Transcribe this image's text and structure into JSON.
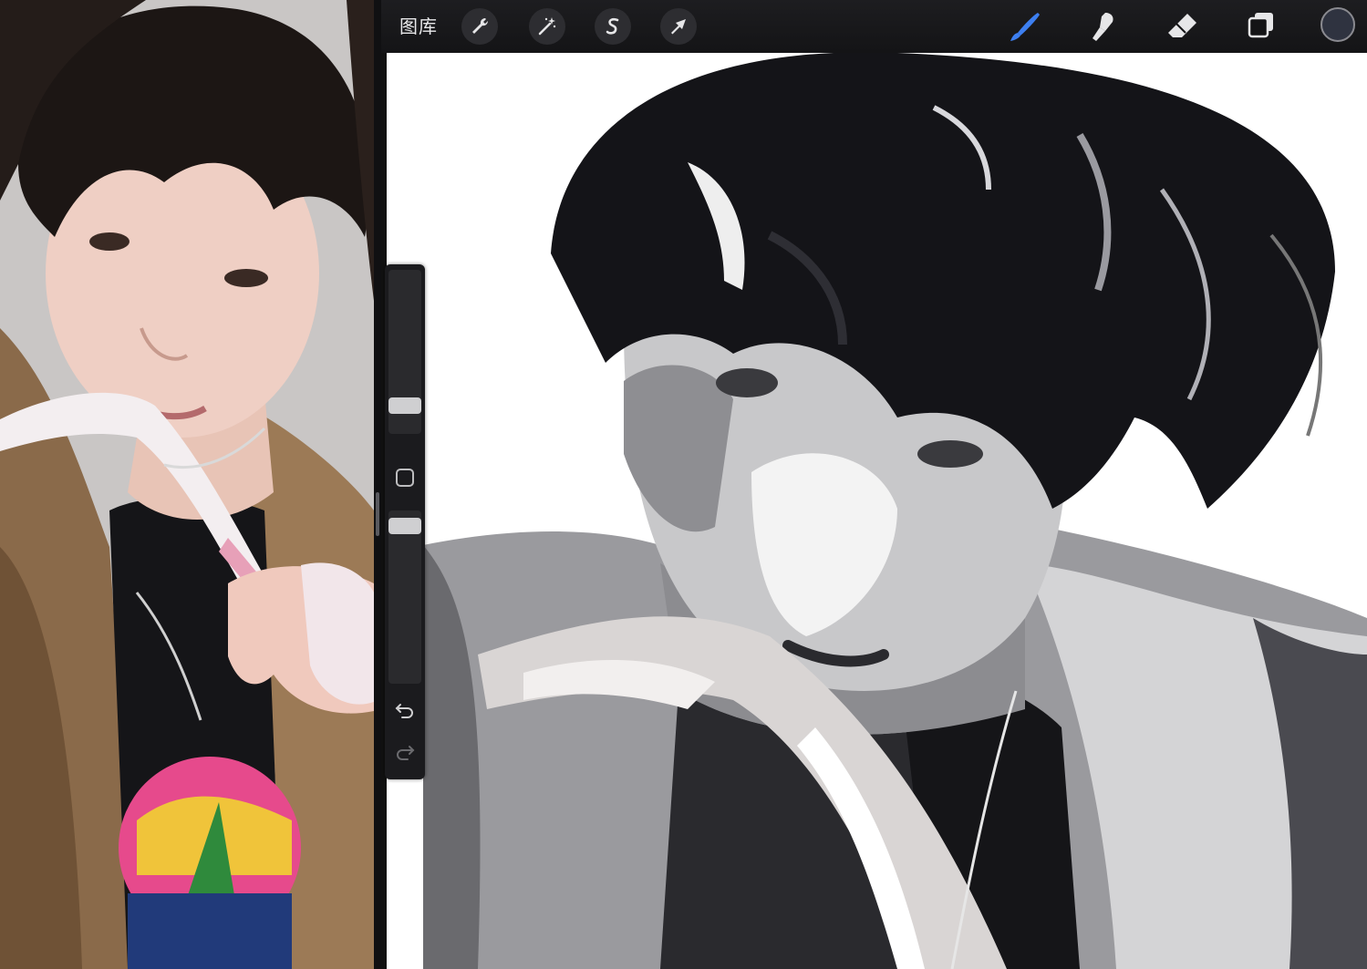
{
  "toolbar": {
    "gallery_label": "图库",
    "left_tools": [
      {
        "icon": "wrench-icon",
        "name": "actions"
      },
      {
        "icon": "magic-wand-icon",
        "name": "adjustments"
      },
      {
        "icon": "selection-s-icon",
        "name": "selection"
      },
      {
        "icon": "arrow-cursor-icon",
        "name": "transform"
      }
    ],
    "right_tools": [
      {
        "icon": "brush-icon",
        "name": "paint",
        "active_color": "#3d7ff0"
      },
      {
        "icon": "smudge-icon",
        "name": "smudge"
      },
      {
        "icon": "eraser-icon",
        "name": "eraser"
      },
      {
        "icon": "layers-icon",
        "name": "layers"
      }
    ],
    "current_color": "#2f3340"
  },
  "sidebar": {
    "brush_size_level": 0.3,
    "opacity_level": 0.95
  },
  "colors": {
    "toolbar_bg": "#1a1a1d",
    "canvas_bg": "#ffffff",
    "accent": "#3d7ff0"
  }
}
